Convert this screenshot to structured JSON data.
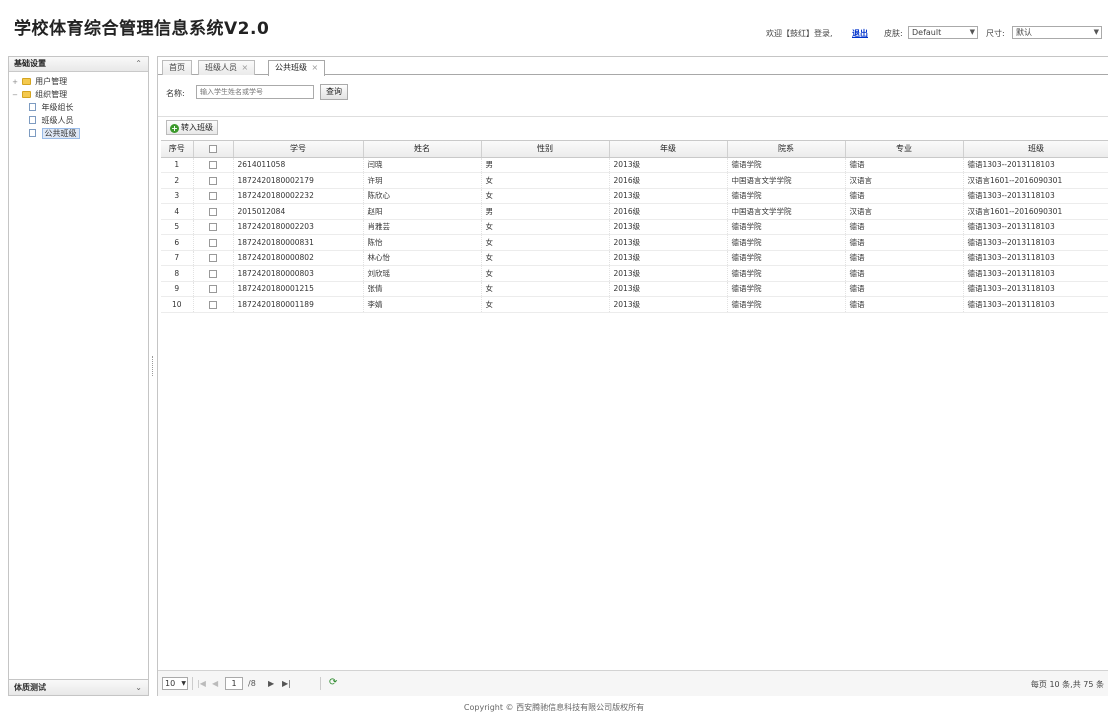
{
  "header": {
    "app_title": "学校体育综合管理信息系统V2.0",
    "user_greeting": "欢迎【鼓红】登录,",
    "logout_label": "退出",
    "skin_label": "皮肤:",
    "skin_value": "Default",
    "size_label": "尺寸:",
    "size_value": "默认"
  },
  "sidebar": {
    "title": "基础设置",
    "collapse_icon": "chevron-up-icon",
    "tree": [
      {
        "label": "用户管理",
        "type": "folder",
        "expanded": false
      },
      {
        "label": "组织管理",
        "type": "folder",
        "expanded": true
      },
      {
        "label": "年级组长",
        "type": "file"
      },
      {
        "label": "班级人员",
        "type": "file"
      },
      {
        "label": "公共班级",
        "type": "file",
        "selected": true
      }
    ],
    "bottom_title": "体质测试"
  },
  "tabs": [
    {
      "label": "首页",
      "closable": false,
      "active": false
    },
    {
      "label": "班级人员",
      "closable": true,
      "active": false
    },
    {
      "label": "公共班级",
      "closable": true,
      "active": true
    }
  ],
  "search": {
    "label": "名称:",
    "placeholder": "输入学生姓名或学号",
    "button_label": "查询"
  },
  "toolbar": {
    "import_label": "转入班级"
  },
  "grid": {
    "columns": [
      "序号",
      "",
      "学号",
      "姓名",
      "性别",
      "年级",
      "院系",
      "专业",
      "班级"
    ],
    "rows": [
      [
        "1",
        "2614011058",
        "闫晓",
        "男",
        "2013级",
        "德语学院",
        "德语",
        "德语1303--2013118103"
      ],
      [
        "2",
        "1872420180002179",
        "许玥",
        "女",
        "2016级",
        "中国语言文学学院",
        "汉语言",
        "汉语言1601--2016090301"
      ],
      [
        "3",
        "1872420180002232",
        "陈欣心",
        "女",
        "2013级",
        "德语学院",
        "德语",
        "德语1303--2013118103"
      ],
      [
        "4",
        "2015012084",
        "赵阳",
        "男",
        "2016级",
        "中国语言文学学院",
        "汉语言",
        "汉语言1601--2016090301"
      ],
      [
        "5",
        "1872420180002203",
        "肖雅芸",
        "女",
        "2013级",
        "德语学院",
        "德语",
        "德语1303--2013118103"
      ],
      [
        "6",
        "1872420180000831",
        "陈怡",
        "女",
        "2013级",
        "德语学院",
        "德语",
        "德语1303--2013118103"
      ],
      [
        "7",
        "1872420180000802",
        "林心怡",
        "女",
        "2013级",
        "德语学院",
        "德语",
        "德语1303--2013118103"
      ],
      [
        "8",
        "1872420180000803",
        "刘欣瑶",
        "女",
        "2013级",
        "德语学院",
        "德语",
        "德语1303--2013118103"
      ],
      [
        "9",
        "1872420180001215",
        "张倩",
        "女",
        "2013级",
        "德语学院",
        "德语",
        "德语1303--2013118103"
      ],
      [
        "10",
        "1872420180001189",
        "李婧",
        "女",
        "2013级",
        "德语学院",
        "德语",
        "德语1303--2013118103"
      ]
    ]
  },
  "pager": {
    "page_size": "10",
    "current_page": "1",
    "total_pages_text": "/8",
    "info": "每页 10 条,共 75 条",
    "first_icon": "first-page-icon",
    "prev_icon": "prev-page-icon",
    "next_icon": "next-page-icon",
    "last_icon": "last-page-icon",
    "refresh_icon": "refresh-icon"
  },
  "footer": {
    "copyright": "Copyright © 西安腾驰信息科技有限公司版权所有"
  }
}
